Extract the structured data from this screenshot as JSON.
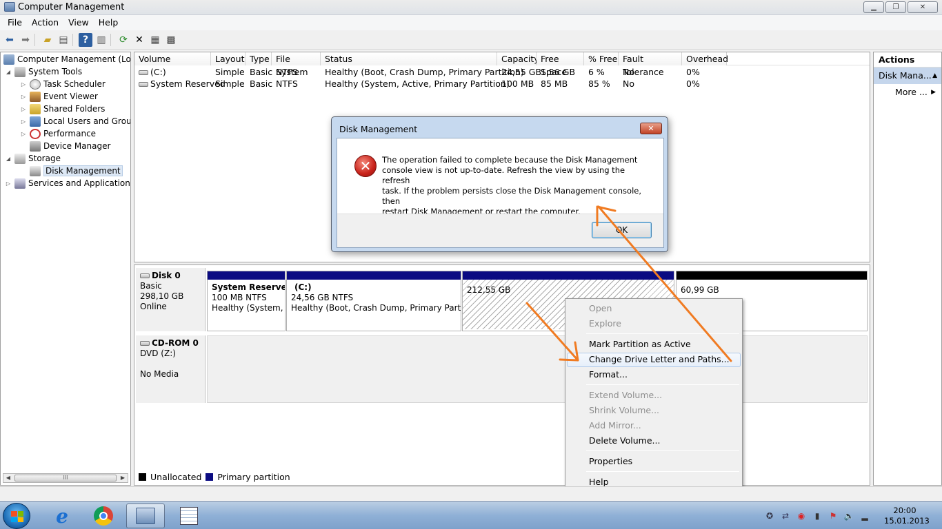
{
  "window": {
    "title": "Computer Management",
    "minimize": "▁",
    "maximize": "❐",
    "close": "✕"
  },
  "menu": [
    "File",
    "Action",
    "View",
    "Help"
  ],
  "toolbar_icons": [
    "back-icon",
    "forward-icon",
    "up-folder-icon",
    "show-tree-icon",
    "help-icon",
    "action-pane-icon",
    "refresh-icon",
    "delete-icon",
    "properties-icon",
    "export-icon"
  ],
  "tree": {
    "root": "Computer Management (Local",
    "system_tools": "System Tools",
    "task_scheduler": "Task Scheduler",
    "event_viewer": "Event Viewer",
    "shared_folders": "Shared Folders",
    "local_users": "Local Users and Groups",
    "performance": "Performance",
    "device_manager": "Device Manager",
    "storage": "Storage",
    "disk_management": "Disk Management",
    "services": "Services and Applications",
    "scroll_thumb": "III"
  },
  "volumes": {
    "headers": [
      "Volume",
      "Layout",
      "Type",
      "File System",
      "Status",
      "Capacity",
      "Free Space",
      "% Free",
      "Fault Tolerance",
      "Overhead"
    ],
    "rows": [
      [
        "(C:)",
        "Simple",
        "Basic",
        "NTFS",
        "Healthy (Boot, Crash Dump, Primary Partition)",
        "24,55 GB",
        "1,56 GB",
        "6 %",
        "No",
        "0%"
      ],
      [
        "System Reserved",
        "Simple",
        "Basic",
        "NTFS",
        "Healthy (System, Active, Primary Partition)",
        "100 MB",
        "85 MB",
        "85 %",
        "No",
        "0%"
      ]
    ]
  },
  "disks": {
    "disk0": {
      "name": "Disk 0",
      "type": "Basic",
      "size": "298,10 GB",
      "status": "Online"
    },
    "cdrom0": {
      "name": "CD-ROM 0",
      "type": "DVD (Z:)",
      "status": "No Media"
    },
    "partitions": {
      "sysres": {
        "title": "System Reserved",
        "size": "100 MB NTFS",
        "status": "Healthy (System, A"
      },
      "c": {
        "title": "(C:)",
        "size": "24,56 GB NTFS",
        "status": "Healthy (Boot, Crash Dump, Primary Partition"
      },
      "p3": {
        "size": "212,55 GB"
      },
      "p4": {
        "size": "60,99 GB"
      }
    },
    "legend": {
      "unallocated": "Unallocated",
      "primary": "Primary partition",
      "unallocated_color": "#000000",
      "primary_color": "#0b0b82"
    }
  },
  "actions": {
    "header": "Actions",
    "selected": "Disk Mana...",
    "more": "More ..."
  },
  "dialog": {
    "title": "Disk Management",
    "close": "✕",
    "message": "The operation failed to complete because the Disk Management\nconsole view is not up-to-date.  Refresh the view by using the refresh\ntask. If the problem persists close the Disk Management console, then\nrestart Disk Management or restart the computer.",
    "ok": "OK",
    "icon": "error-icon"
  },
  "context_menu": {
    "open": "Open",
    "explore": "Explore",
    "mark_active": "Mark Partition as Active",
    "change_letter": "Change Drive Letter and Paths...",
    "format": "Format...",
    "extend": "Extend Volume...",
    "shrink": "Shrink Volume...",
    "add_mirror": "Add Mirror...",
    "delete": "Delete Volume...",
    "properties": "Properties",
    "help": "Help"
  },
  "annotation_color": "#f07b22",
  "taskbar": {
    "apps": [
      "internet-explorer-icon",
      "chrome-icon",
      "computer-management-icon",
      "notepad-icon"
    ],
    "tray": [
      "network-share-icon",
      "sync-icon",
      "record-icon",
      "battery-icon",
      "flag-icon",
      "volume-icon",
      "signal-icon"
    ],
    "time": "20:00",
    "date": "15.01.2013"
  }
}
